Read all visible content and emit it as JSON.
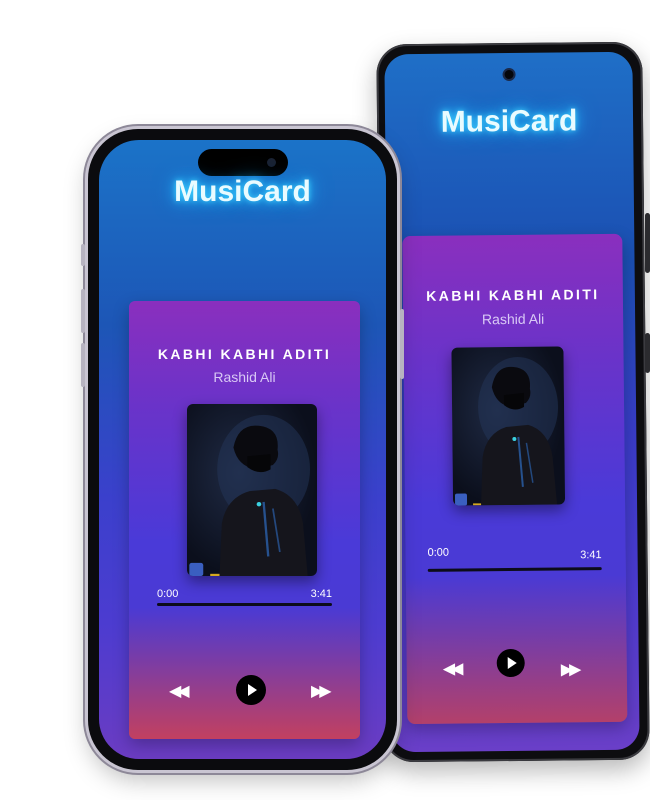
{
  "app": {
    "name": "MusiCard"
  },
  "track": {
    "title": "KABHI KABHI ADITI",
    "artist": "Rashid Ali",
    "current_time": "0:00",
    "duration": "3:41",
    "progress": 0
  },
  "icons": {
    "rewind": "rewind-icon",
    "play": "play-icon",
    "fast_forward": "fast-forward-icon"
  },
  "colors": {
    "glow": "#2bbcff",
    "card_top": "#8a2fbe",
    "card_bottom": "#c24060",
    "screen_top": "#1b73c8"
  }
}
